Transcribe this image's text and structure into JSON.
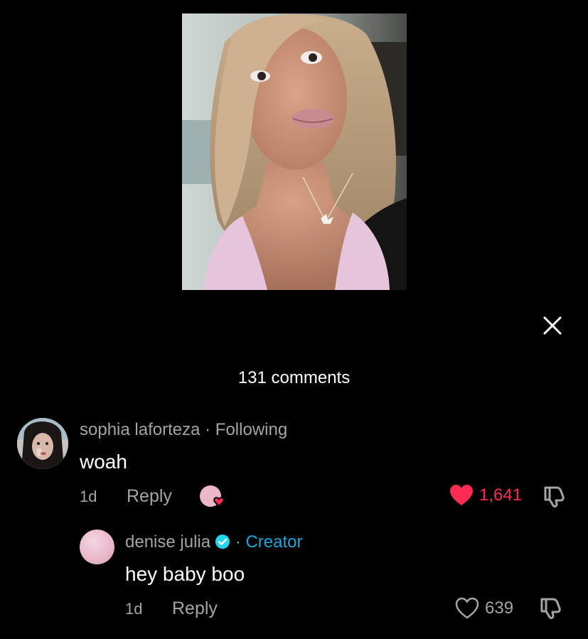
{
  "header": {
    "comments_count_label": "131 comments"
  },
  "icons": {
    "close": "close-icon",
    "like_filled": "heart-filled-icon",
    "like_outline": "heart-outline-icon",
    "dislike": "thumbs-down-icon",
    "verified": "verified-badge-icon"
  },
  "colors": {
    "background": "#000000",
    "liked_red": "#fe2c55",
    "muted_text": "#a4a4a4",
    "creator_blue": "#1fa6d6"
  },
  "comments": [
    {
      "username": "sophia laforteza",
      "separator": "·",
      "relation": "Following",
      "text": "woah",
      "age": "1d",
      "reply_label": "Reply",
      "liked_by_creator": true,
      "likes": "1,641",
      "liked": true
    },
    {
      "username": "denise julia",
      "verified": true,
      "separator": "·",
      "relation": "Creator",
      "text": "hey baby boo",
      "age": "1d",
      "reply_label": "Reply",
      "likes": "639",
      "liked": false
    }
  ]
}
